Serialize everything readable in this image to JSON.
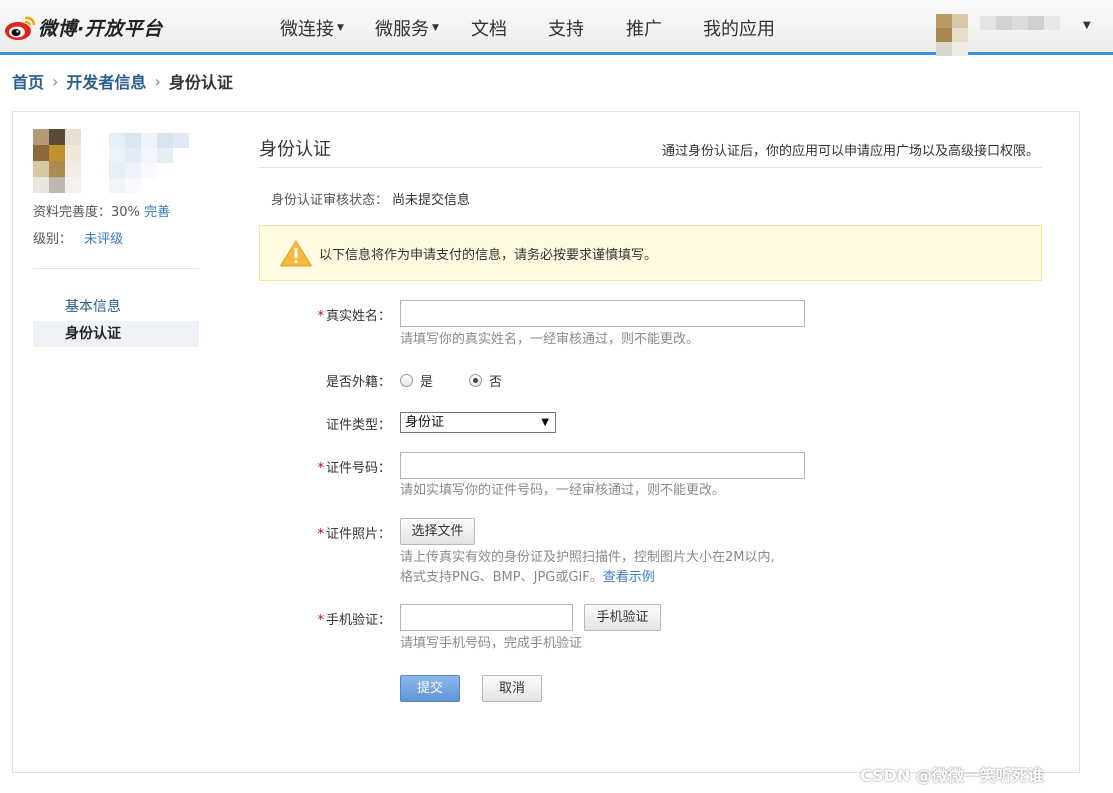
{
  "brand": {
    "logo_text": "微博·开放平台",
    "logo_colors": {
      "eye": "#e2231a",
      "pupil": "#000000",
      "wave": "#f4a100"
    }
  },
  "nav": {
    "items": [
      {
        "label": "微连接",
        "dropdown": true
      },
      {
        "label": "微服务",
        "dropdown": true
      },
      {
        "label": "文档",
        "dropdown": false
      },
      {
        "label": "支持",
        "dropdown": false
      },
      {
        "label": "推广",
        "dropdown": false
      },
      {
        "label": "我的应用",
        "dropdown": false
      }
    ],
    "accent": "#3b8fd3",
    "user_menu_caret": "▼"
  },
  "breadcrumb": {
    "items": [
      "首页",
      "开发者信息",
      "身份认证"
    ],
    "separator": "›"
  },
  "sidebar": {
    "completeness_label": "资料完善度：",
    "completeness_value": "30%",
    "complete_link": "完善",
    "level_label": "级别：",
    "level_value": "未评级",
    "menu": [
      {
        "label": "基本信息",
        "active": false
      },
      {
        "label": "身份认证",
        "active": true
      }
    ]
  },
  "main": {
    "title": "身份认证",
    "hint": "通过身份认证后，你的应用可以申请应用广场以及高级接口权限。",
    "status_label": "身份认证审核状态：",
    "status_value": "尚未提交信息",
    "notice": {
      "icon": "warning-icon",
      "text": "以下信息将作为申请支付的信息，请务必按要求谨慎填写。"
    },
    "form": {
      "real_name": {
        "required": "*",
        "label": "真实姓名：",
        "value": "",
        "help": "请填写你的真实姓名，一经审核通过，则不能更改。"
      },
      "foreign": {
        "label": "是否外籍：",
        "options": [
          {
            "label": "是",
            "checked": false
          },
          {
            "label": "否",
            "checked": true
          }
        ]
      },
      "id_type": {
        "label": "证件类型：",
        "selected": "身份证"
      },
      "id_number": {
        "required": "*",
        "label": "证件号码：",
        "value": "",
        "help": "请如实填写你的证件号码，一经审核通过，则不能更改。"
      },
      "id_photo": {
        "required": "*",
        "label": "证件照片：",
        "button": "选择文件",
        "help_line1": "请上传真实有效的身份证及护照扫描件，控制图片大小在2M以内,",
        "help_line2": "格式支持PNG、BMP、JPG或GIF。",
        "help_link": "查看示例"
      },
      "phone": {
        "required": "*",
        "label": "手机验证：",
        "value": "",
        "button": "手机验证",
        "help": "请填写手机号码，完成手机验证"
      },
      "submit_label": "提交",
      "cancel_label": "取消"
    }
  },
  "watermark": "CSDN @微微一笑听死谁"
}
